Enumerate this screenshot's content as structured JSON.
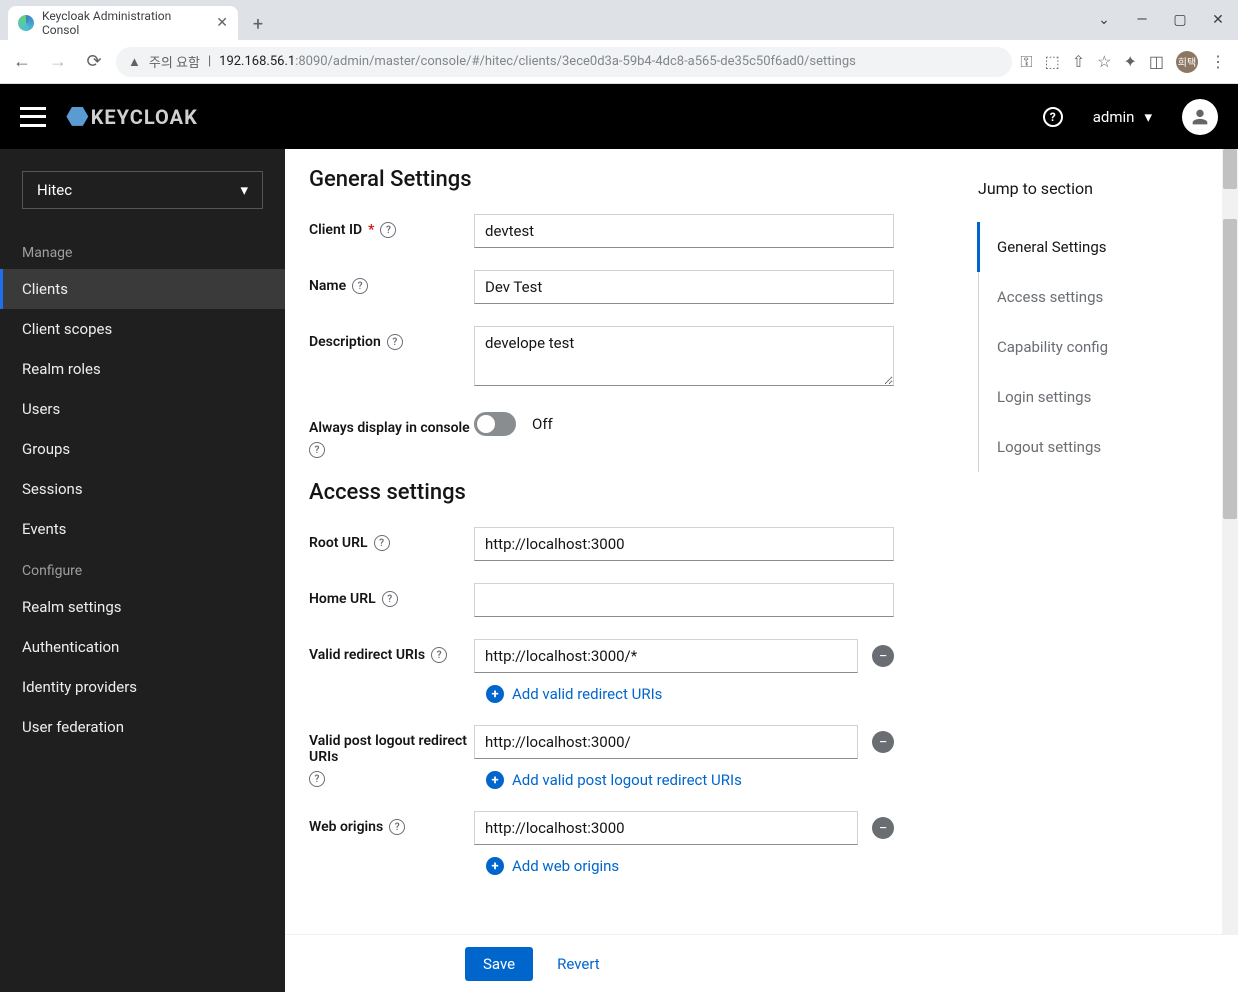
{
  "browser": {
    "tab_title": "Keycloak Administration Consol",
    "warn_text": "주의 요함",
    "url_host": "192.168.56.1",
    "url_port": ":8090",
    "url_path": "/admin/master/console/#/hitec/clients/3ece0d3a-59b4-4dc8-a565-de35c50f6ad0/settings",
    "avatar_initials": "희택"
  },
  "header": {
    "logo_text": "KEYCLOAK",
    "username": "admin"
  },
  "sidebar": {
    "realm": "Hitec",
    "manage_label": "Manage",
    "configure_label": "Configure",
    "manage": [
      {
        "label": "Clients",
        "active": true
      },
      {
        "label": "Client scopes"
      },
      {
        "label": "Realm roles"
      },
      {
        "label": "Users"
      },
      {
        "label": "Groups"
      },
      {
        "label": "Sessions"
      },
      {
        "label": "Events"
      }
    ],
    "configure": [
      {
        "label": "Realm settings"
      },
      {
        "label": "Authentication"
      },
      {
        "label": "Identity providers"
      },
      {
        "label": "User federation"
      }
    ]
  },
  "form": {
    "general_title": "General Settings",
    "client_id_label": "Client ID",
    "client_id_value": "devtest",
    "name_label": "Name",
    "name_value": "Dev Test",
    "description_label": "Description",
    "description_value": "develope test",
    "always_display_label": "Always display in console",
    "switch_off": "Off",
    "access_title": "Access settings",
    "root_url_label": "Root URL",
    "root_url_value": "http://localhost:3000",
    "home_url_label": "Home URL",
    "home_url_value": "",
    "valid_redirect_label": "Valid redirect URIs",
    "valid_redirect_value": "http://localhost:3000/*",
    "add_redirect": "Add valid redirect URIs",
    "valid_post_logout_label": "Valid post logout redirect URIs",
    "valid_post_logout_value": "http://localhost:3000/",
    "add_post_logout": "Add valid post logout redirect URIs",
    "web_origins_label": "Web origins",
    "web_origins_value": "http://localhost:3000",
    "add_web_origins": "Add web origins"
  },
  "jump": {
    "title": "Jump to section",
    "items": [
      {
        "label": "General Settings",
        "active": true
      },
      {
        "label": "Access settings"
      },
      {
        "label": "Capability config"
      },
      {
        "label": "Login settings"
      },
      {
        "label": "Logout settings"
      }
    ]
  },
  "footer": {
    "save": "Save",
    "revert": "Revert"
  }
}
